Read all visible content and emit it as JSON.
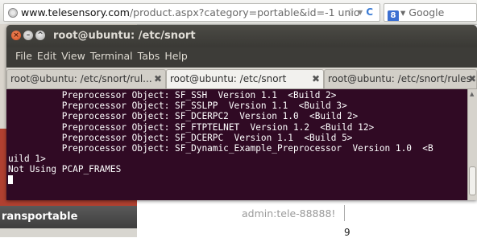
{
  "browser": {
    "url_host": "www.telesensory.com",
    "url_path": "/product.aspx?category=portable&id=-1 unio",
    "star_icon": "star-icon",
    "dropdown_glyph": "▾",
    "reload_glyph": "C",
    "search_text": "Google",
    "search_badge": "8"
  },
  "page": {
    "sidebar_title": "ransportable",
    "credential_text": "admin:tele-88888!",
    "page_number": "9"
  },
  "terminal": {
    "title": "root@ubuntu: /etc/snort",
    "menu": [
      "File",
      "Edit",
      "View",
      "Terminal",
      "Tabs",
      "Help"
    ],
    "tabs": [
      {
        "label": "root@ubuntu: /etc/snort/rul...",
        "close": "✖",
        "active": false
      },
      {
        "label": "root@ubuntu: /etc/snort",
        "close": "✖",
        "active": true
      },
      {
        "label": "root@ubuntu: /etc/snort/rules",
        "close": "✖",
        "active": false
      }
    ],
    "output_lines": [
      "          Preprocessor Object: SF_SSH  Version 1.1  <Build 2>",
      "          Preprocessor Object: SF_SSLPP  Version 1.1  <Build 3>",
      "          Preprocessor Object: SF_DCERPC2  Version 1.0  <Build 2>",
      "          Preprocessor Object: SF_FTPTELNET  Version 1.2  <Build 12>",
      "          Preprocessor Object: SF_DCERPC  Version 1.1  <Build 5>",
      "          Preprocessor Object: SF_Dynamic_Example_Preprocessor  Version 1.0  <B",
      "uild 1>",
      "Not Using PCAP_FRAMES"
    ],
    "colors": {
      "background": "#300a24",
      "foreground": "#ffffff",
      "chrome": "#3d3c38"
    }
  }
}
